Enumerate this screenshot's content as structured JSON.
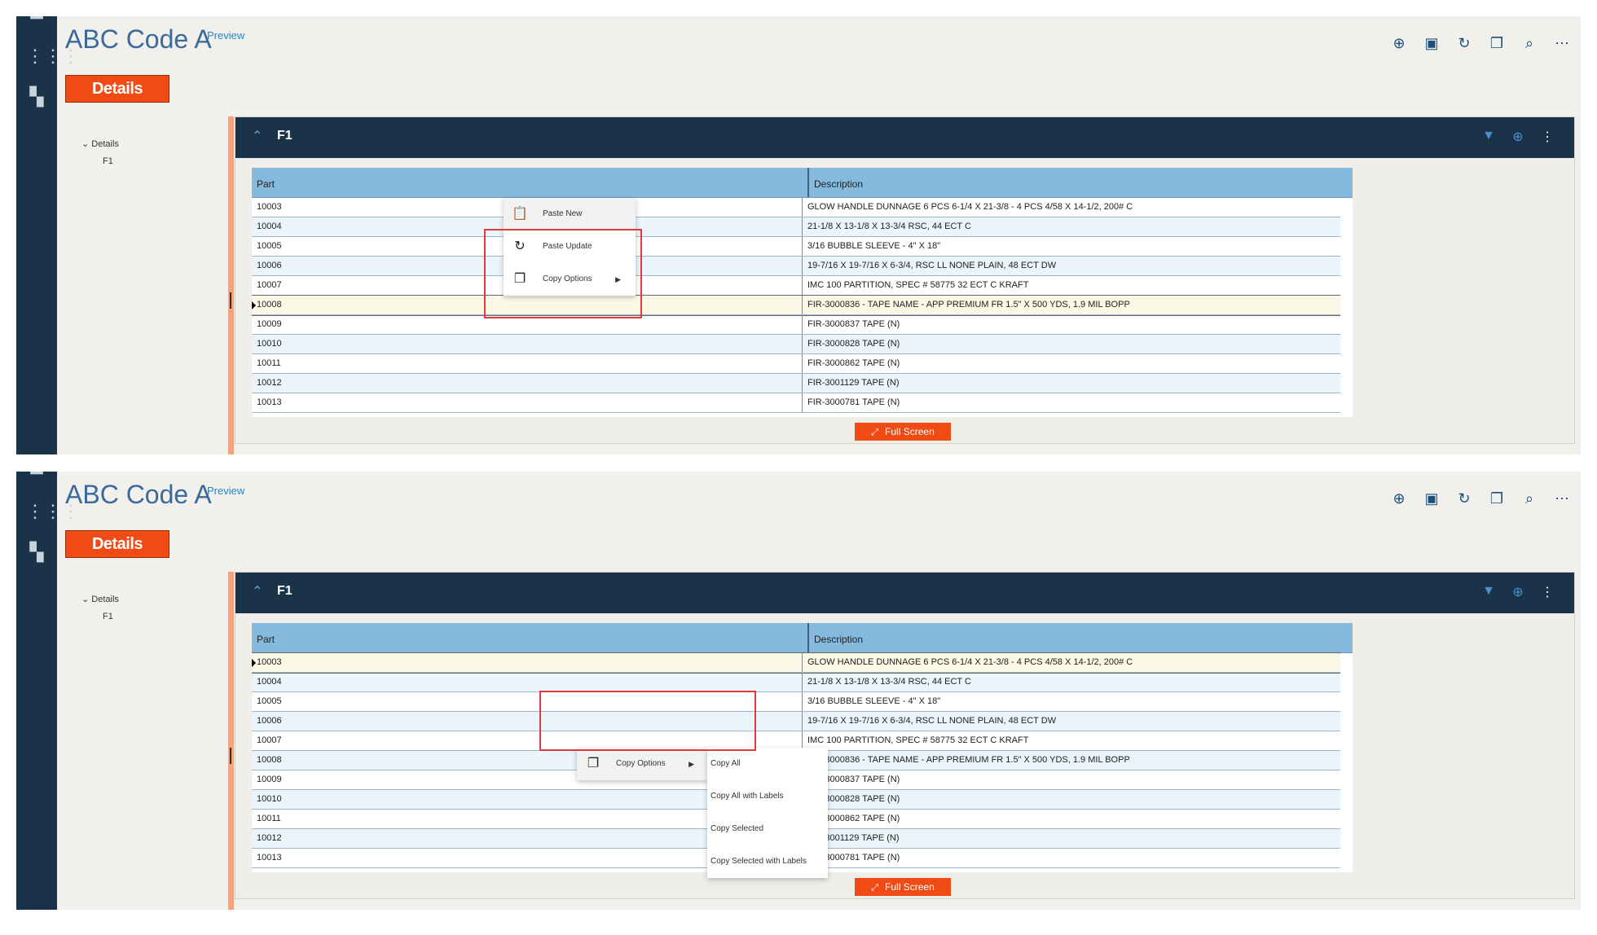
{
  "app": {
    "title": "ABC Code A",
    "preview_label": "Preview",
    "details_button": "Details",
    "tree": {
      "root": "Details",
      "child": "F1"
    },
    "section_title": "F1",
    "fullscreen_label": "Full Screen"
  },
  "icons": {
    "rail": [
      "home-icon",
      "apps-grid-icon",
      "dashboard-icon"
    ],
    "toolbar": [
      "add-circle-icon",
      "save-icon",
      "refresh-icon",
      "copy-icon",
      "search-icon",
      "more-icon"
    ],
    "section_tools": [
      "filter-icon",
      "add-icon",
      "kebab-icon"
    ]
  },
  "colors": {
    "rail": "#1b3349",
    "accent": "#f04a15",
    "title": "#3a6b9a",
    "grid_header": "#85b9de",
    "callout": "#e23a3a"
  },
  "grid": {
    "columns": [
      "Part",
      "Description"
    ],
    "rows": [
      {
        "part": "10003",
        "desc": "GLOW HANDLE DUNNAGE 6 PCS 6-1/4 X 21-3/8 - 4 PCS 4/58 X 14-1/2, 200# C"
      },
      {
        "part": "10004",
        "desc": "21-1/8 X 13-1/8 X 13-3/4 RSC, 44 ECT C"
      },
      {
        "part": "10005",
        "desc": "3/16 BUBBLE SLEEVE - 4\" X 18\""
      },
      {
        "part": "10006",
        "desc": "19-7/16 X 19-7/16 X 6-3/4, RSC LL NONE PLAIN, 48 ECT DW"
      },
      {
        "part": "10007",
        "desc": "IMC 100 PARTITION, SPEC # 58775 32 ECT C KRAFT"
      },
      {
        "part": "10008",
        "desc": "FIR-3000836 - TAPE NAME - APP PREMIUM FR 1.5\" X 500 YDS, 1.9 MIL BOPP"
      },
      {
        "part": "10009",
        "desc": "FIR-3000837 TAPE (N)"
      },
      {
        "part": "10010",
        "desc": "FIR-3000828 TAPE (N)"
      },
      {
        "part": "10011",
        "desc": "FIR-3000862 TAPE (N)"
      },
      {
        "part": "10012",
        "desc": "FIR-3001129 TAPE (N)"
      },
      {
        "part": "10013",
        "desc": "FIR-3000781 TAPE (N)"
      }
    ]
  },
  "context_menu": {
    "paste_new": "Paste New",
    "paste_update": "Paste Update",
    "copy_options": "Copy Options"
  },
  "copy_submenu": [
    "Copy All",
    "Copy All with Labels",
    "Copy Selected",
    "Copy Selected with Labels"
  ]
}
